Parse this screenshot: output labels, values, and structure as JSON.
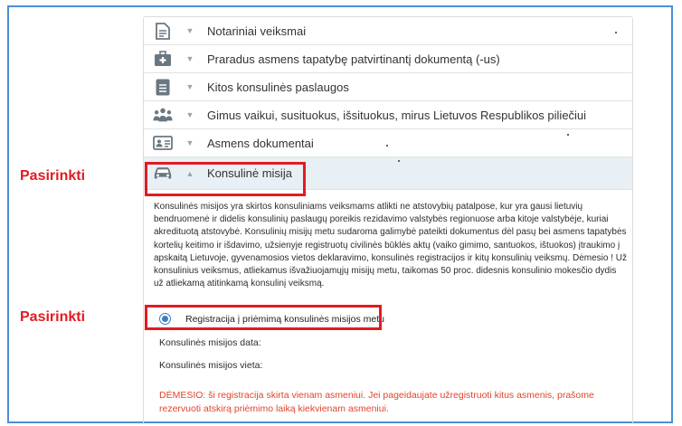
{
  "accordion": {
    "items": [
      {
        "label": "Notariniai veiksmai",
        "icon": "document-icon",
        "caret": "▼"
      },
      {
        "label": "Praradus asmens tapatybę patvirtinantį dokumentą (-us)",
        "icon": "first-aid-kit-icon",
        "caret": "▼"
      },
      {
        "label": "Kitos konsulinės paslaugos",
        "icon": "list-document-icon",
        "caret": "▼"
      },
      {
        "label": "Gimus vaikui, susituokus, išsituokus, mirus Lietuvos Respublikos piliečiui",
        "icon": "people-group-icon",
        "caret": "▼"
      },
      {
        "label": "Asmens dokumentai",
        "icon": "id-card-icon",
        "caret": "▼"
      },
      {
        "label": "Konsulinė misija",
        "icon": "car-icon",
        "caret": "▲"
      }
    ]
  },
  "mission": {
    "description": "Konsulinės misijos yra skirtos konsuliniams veiksmams atlikti ne atstovybių patalpose, kur yra gausi lietuvių bendruomenė ir didelis konsulinių paslaugų poreikis rezidavimo valstybės regionuose arba kitoje valstybėje, kuriai akredituotą atstovybė. Konsulinių misijų metu sudaroma galimybė pateikti dokumentus dėl pasų bei asmens tapatybės kortelių keitimo ir išdavimo, užsienyje registruotų civilinės būklės aktų (vaiko gimimo, santuokos, ištuokos) įtraukimo į apskaitą Lietuvoje, gyvenamosios vietos deklaravimo, konsulinės registracijos ir kitų konsulinių veiksmų. Dėmesio ! Už konsulinius veiksmus, atliekamus išvažiuojamųjų misijų metu, taikomas 50 proc. didesnis konsulinio mokesčio dydis už atliekamą atitinkamą konsulinį veiksmą.",
    "radio_label": "Registracija į priėmimą konsulinės misijos metu",
    "date_label": "Konsulinės misijos data:",
    "place_label": "Konsulinės misijos vieta:",
    "warning": "DĖMESIO: ši registracija skirta vienam asmeniui. Jei pageidaujate užregistruoti kitus asmenis, prašome rezervuoti atskirą priėmimo laiką kiekvienam asmeniui."
  },
  "annotations": {
    "label_1": "Pasirinkti",
    "label_2": "Pasirinkti"
  },
  "colors": {
    "annotation_red": "#e11b22",
    "icon_grey": "#6b7780",
    "accent_blue": "#3a7fc4",
    "warning_text": "#e0452c",
    "active_row_bg": "#e8f0f5"
  }
}
